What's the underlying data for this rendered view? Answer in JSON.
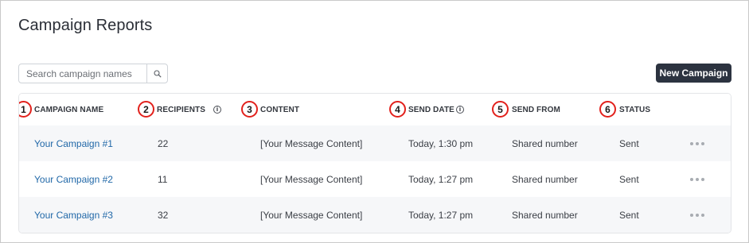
{
  "page": {
    "title": "Campaign Reports"
  },
  "search": {
    "placeholder": "Search campaign names",
    "icon": "search-icon"
  },
  "toolbar": {
    "new_campaign_label": "New Campaign"
  },
  "table": {
    "columns": [
      {
        "badge": "1",
        "label": "CAMPAIGN NAME",
        "info": false
      },
      {
        "badge": "2",
        "label": "RECIPIENTS",
        "info": true
      },
      {
        "badge": "3",
        "label": "CONTENT",
        "info": false
      },
      {
        "badge": "4",
        "label": "SEND DATE",
        "info": true
      },
      {
        "badge": "5",
        "label": "SEND FROM",
        "info": false
      },
      {
        "badge": "6",
        "label": "STATUS",
        "info": false
      }
    ],
    "info_glyph": "i",
    "rows": [
      {
        "name": "Your Campaign #1",
        "recipients": "22",
        "content": "[Your Message Content]",
        "send_date": "Today, 1:30 pm",
        "send_from": "Shared number",
        "status": "Sent"
      },
      {
        "name": "Your Campaign #2",
        "recipients": "11",
        "content": "[Your Message Content]",
        "send_date": "Today, 1:27 pm",
        "send_from": "Shared number",
        "status": "Sent"
      },
      {
        "name": "Your Campaign #3",
        "recipients": "32",
        "content": "[Your Message Content]",
        "send_date": "Today, 1:27 pm",
        "send_from": "Shared number",
        "status": "Sent"
      }
    ]
  },
  "colors": {
    "link": "#2168a8",
    "primary_button": "#2c3340",
    "annotation_badge": "#e2211c",
    "row_shade": "#f6f7f9"
  }
}
